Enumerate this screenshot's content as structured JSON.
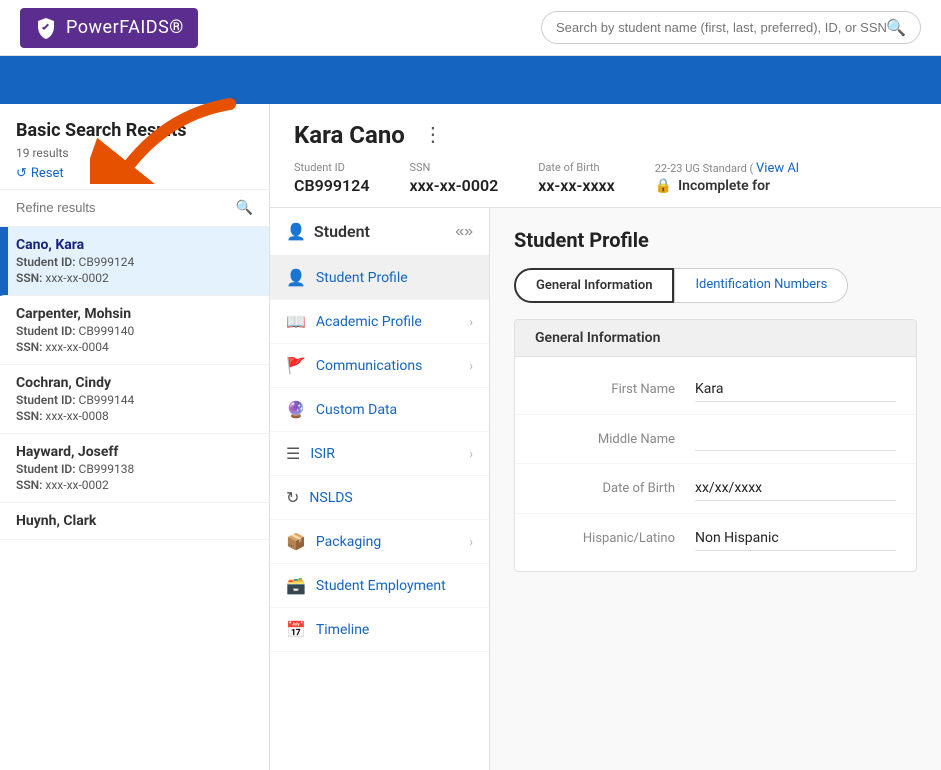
{
  "header": {
    "logo_text_bold": "Power",
    "logo_text_regular": "FAIDS",
    "search_placeholder": "Search by student name (first, last, preferred), ID, or SSN"
  },
  "sidebar": {
    "title": "Basic Search Results",
    "count": "19 results",
    "reset_label": "Reset",
    "refine_placeholder": "Refine results",
    "students": [
      {
        "name": "Cano, Kara",
        "id_label": "Student ID:",
        "id_value": "CB999124",
        "ssn_label": "SSN:",
        "ssn_value": "xxx-xx-0002",
        "active": true
      },
      {
        "name": "Carpenter, Mohsin",
        "id_label": "Student ID:",
        "id_value": "CB999140",
        "ssn_label": "SSN:",
        "ssn_value": "xxx-xx-0004",
        "active": false
      },
      {
        "name": "Cochran, Cindy",
        "id_label": "Student ID:",
        "id_value": "CB999144",
        "ssn_label": "SSN:",
        "ssn_value": "xxx-xx-0008",
        "active": false
      },
      {
        "name": "Hayward, Joseff",
        "id_label": "Student ID:",
        "id_value": "CB999138",
        "ssn_label": "SSN:",
        "ssn_value": "xxx-xx-0002",
        "active": false
      },
      {
        "name": "Huynh, Clark",
        "id_label": "",
        "id_value": "",
        "ssn_label": "",
        "ssn_value": "",
        "active": false
      }
    ]
  },
  "student_header": {
    "name": "Kara Cano",
    "student_id_label": "Student ID",
    "student_id_value": "CB999124",
    "ssn_label": "SSN",
    "ssn_value": "xxx-xx-0002",
    "dob_label": "Date of Birth",
    "dob_value": "xx-xx-xxxx",
    "status_label": "22-23 UG Standard (",
    "view_all": "View Al",
    "incomplete_text": "Incomplete for"
  },
  "nav_menu": {
    "title": "Student",
    "items": [
      {
        "label": "Student Profile",
        "icon": "person",
        "has_arrow": false,
        "active": true
      },
      {
        "label": "Academic Profile",
        "icon": "book",
        "has_arrow": true,
        "active": false
      },
      {
        "label": "Communications",
        "icon": "flag",
        "has_arrow": true,
        "active": false
      },
      {
        "label": "Custom Data",
        "icon": "data",
        "has_arrow": false,
        "active": false
      },
      {
        "label": "ISIR",
        "icon": "list",
        "has_arrow": true,
        "active": false
      },
      {
        "label": "NSLDS",
        "icon": "refresh",
        "has_arrow": false,
        "active": false
      },
      {
        "label": "Packaging",
        "icon": "box",
        "has_arrow": true,
        "active": false
      },
      {
        "label": "Student Employment",
        "icon": "briefcase",
        "has_arrow": false,
        "active": false
      },
      {
        "label": "Timeline",
        "icon": "calendar",
        "has_arrow": false,
        "active": false
      }
    ]
  },
  "profile": {
    "title": "Student Profile",
    "tabs": [
      {
        "label": "General Information",
        "active": true
      },
      {
        "label": "Identification Numbers",
        "active": false
      }
    ],
    "section_title": "General Information",
    "fields": [
      {
        "label": "First Name",
        "value": "Kara",
        "empty": false
      },
      {
        "label": "Middle Name",
        "value": "",
        "empty": true
      },
      {
        "label": "Date of Birth",
        "value": "xx/xx/xxxx",
        "empty": false
      },
      {
        "label": "Hispanic/Latino",
        "value": "Non Hispanic",
        "empty": false
      }
    ]
  }
}
